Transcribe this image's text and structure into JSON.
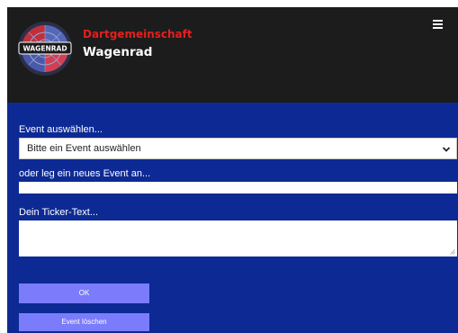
{
  "header": {
    "logo_text": "WAGENRAD",
    "brand_line1": "Dartgemeinschaft",
    "brand_line2": "Wagenrad",
    "menu_icon": "hamburger-menu-icon"
  },
  "form": {
    "event_select_label": "Event auswählen...",
    "event_select_value": "Bitte ein Event auswählen",
    "new_event_label": "oder leg ein neues Event an...",
    "new_event_value": "",
    "ticker_label": "Dein Ticker-Text...",
    "ticker_value": "",
    "ok_button": "OK",
    "delete_button": "Event löschen"
  },
  "colors": {
    "header_bg": "#1c1c1c",
    "page_bg": "#0d2a94",
    "brand_red": "#e0201e",
    "button_bg": "#7b7cfb"
  }
}
